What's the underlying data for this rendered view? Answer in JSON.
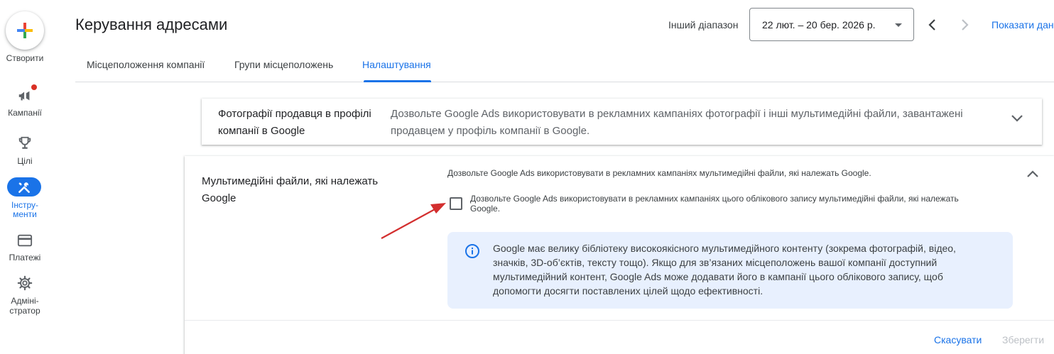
{
  "rail": {
    "create_label": "Створити",
    "items": [
      {
        "label": "Кампанії",
        "icon": "megaphone-icon"
      },
      {
        "label": "Цілі",
        "icon": "trophy-icon"
      },
      {
        "label_line1": "Інстру-",
        "label_line2": "менти",
        "icon": "tools-icon",
        "active": true
      },
      {
        "label": "Платежі",
        "icon": "credit-card-icon"
      },
      {
        "label_line1": "Адміні-",
        "label_line2": "стратор",
        "icon": "gear-icon"
      }
    ]
  },
  "header": {
    "title": "Керування адресами",
    "range_label": "Інший діапазон",
    "date_range": "22 лют. – 20 бер. 2026 р.",
    "show_link": "Показати дан"
  },
  "tabs": [
    {
      "label": "Місцеположення компанії"
    },
    {
      "label": "Групи місцеположень"
    },
    {
      "label": "Налаштування",
      "active": true
    }
  ],
  "card1": {
    "title": "Фотографії продавця в профілі компанії в Google",
    "description": "Дозвольте Google Ads використовувати в рекламних кампаніях фотографії і інші мультимедійні файли, завантажені продавцем у профіль компанії в Google."
  },
  "card2": {
    "title": "Мультимедійні файли, які належать Google",
    "intro": "Дозвольте Google Ads використовувати в рекламних кампаніях мультимедійні файли, які належать Google.",
    "checkbox_label": "Дозвольте Google Ads використовувати в рекламних кампаніях цього облікового запису мультимедійні файли, які належать Google.",
    "checkbox_checked": false,
    "info_text": "Google має велику бібліотеку високоякісного мультимедійного контенту (зокрема фотографій, відео, значків, 3D-об’єктів, тексту тощо). Якщо для зв’язаних місцеположень вашої компанії доступний мультимедійний контент, Google Ads може додавати його в кампанії цього облікового запису, щоб допомогти досягти поставлених цілей щодо ефективності.",
    "cancel_label": "Скасувати",
    "save_label": "Зберегти"
  },
  "colors": {
    "accent": "#1a73e8",
    "info_bg": "#e8f0fe",
    "annotation_arrow": "#d32f2f",
    "notification_dot": "#d93025"
  }
}
